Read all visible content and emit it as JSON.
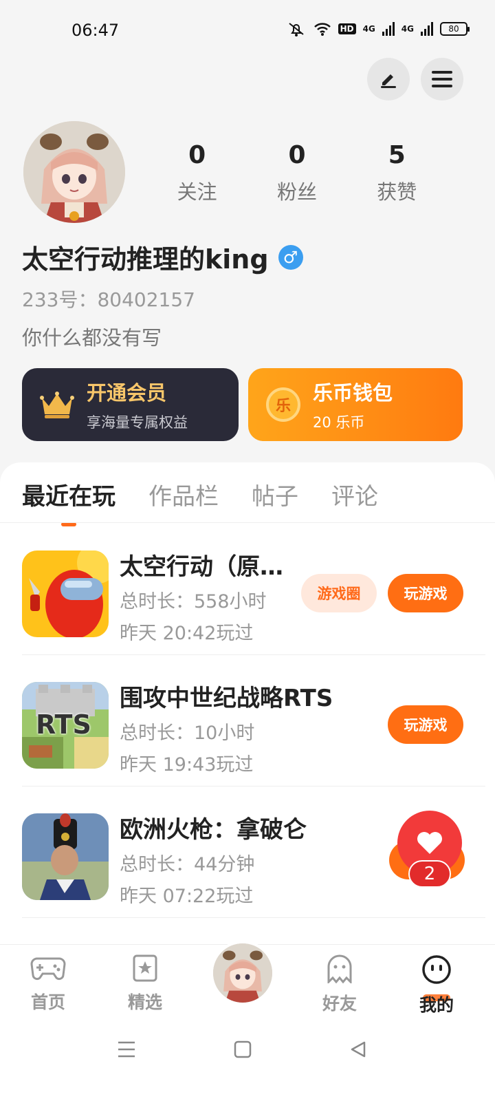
{
  "status_bar": {
    "time": "06:47",
    "hd_label": "HD",
    "net1": "4G",
    "net2": "4G",
    "battery": "80"
  },
  "profile": {
    "stats": [
      {
        "num": "0",
        "label": "关注"
      },
      {
        "num": "0",
        "label": "粉丝"
      },
      {
        "num": "5",
        "label": "获赞"
      }
    ],
    "name": "太空行动推理的king",
    "gender_symbol": "♂",
    "uid": "233号：80402157",
    "bio": "你什么都没有写"
  },
  "cards": {
    "vip": {
      "title": "开通会员",
      "subtitle": "享海量专属权益"
    },
    "wallet": {
      "title": "乐币钱包",
      "subtitle": "20 乐币",
      "coin_text": "乐"
    }
  },
  "tabs": [
    "最近在玩",
    "作品栏",
    "帖子",
    "评论"
  ],
  "games": [
    {
      "title": "太空行动（原…",
      "duration": "总时长：558小时",
      "last_played": "昨天 20:42玩过",
      "circle_btn": "游戏圈",
      "play_btn": "玩游戏"
    },
    {
      "title": "围攻中世纪战略RTS",
      "duration": "总时长：10小时",
      "last_played": "昨天 19:43玩过",
      "play_btn": "玩游戏",
      "thumb_text": "RTS"
    },
    {
      "title": "欧洲火枪：拿破仑",
      "duration": "总时长：44分钟",
      "last_played": "昨天 07:22玩过"
    }
  ],
  "like_badge": {
    "count": "2"
  },
  "bottom_nav": {
    "items": [
      {
        "label": "首页",
        "icon": "gamepad-icon"
      },
      {
        "label": "精选",
        "icon": "star-bookmark-icon"
      },
      {
        "label": "好友",
        "icon": "ghost-icon"
      },
      {
        "label": "我的",
        "icon": "smiley-icon"
      }
    ],
    "active": "我的"
  },
  "colors": {
    "accent": "#ff6e13",
    "vip_bg": "#2a2a38",
    "gender": "#3b9ef0",
    "like": "#f23a3a"
  }
}
